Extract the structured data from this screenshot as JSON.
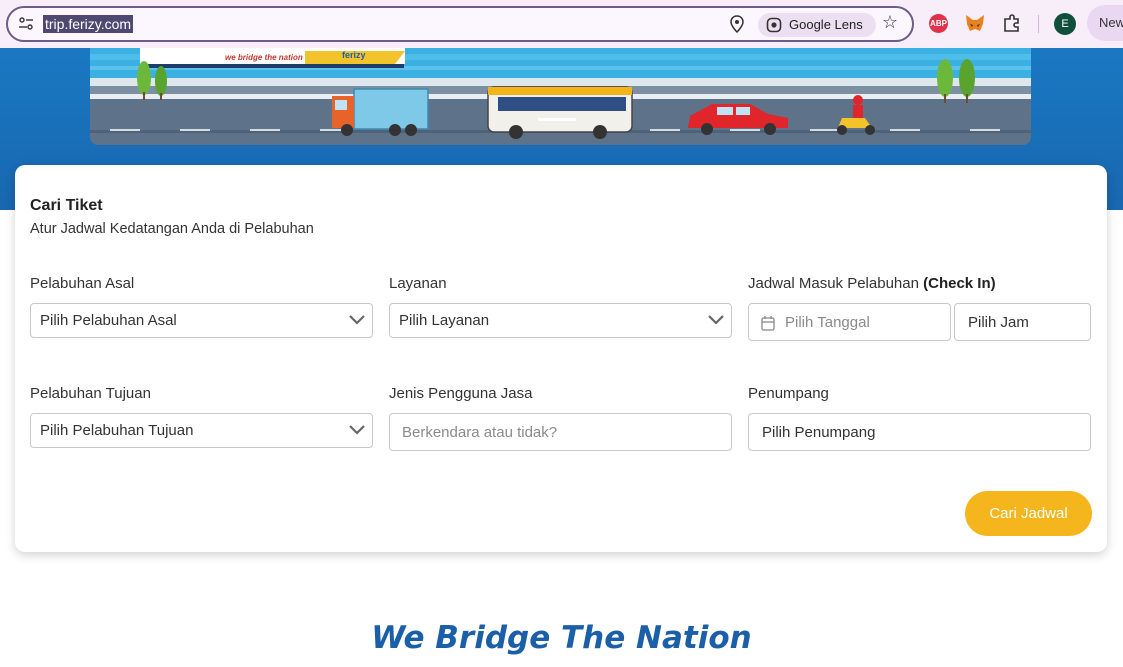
{
  "browser": {
    "url": "trip.ferizy.com",
    "lens_label": "Google Lens",
    "extension_abp": "ABP",
    "profile_initial": "E",
    "new_chip_label": "New"
  },
  "banner": {
    "ship_slogan": "we bridge the nation",
    "ship_brand": "ferizy"
  },
  "search_card": {
    "title": "Cari Tiket",
    "subtitle": "Atur Jadwal Kedatangan Anda di Pelabuhan",
    "origin": {
      "label": "Pelabuhan Asal",
      "value": "Pilih Pelabuhan Asal"
    },
    "service": {
      "label": "Layanan",
      "value": "Pilih Layanan"
    },
    "checkin": {
      "label": "Jadwal Masuk Pelabuhan",
      "label_bold": "(Check In)",
      "date_placeholder": "Pilih Tanggal",
      "time_value": "Pilih Jam"
    },
    "destination": {
      "label": "Pelabuhan Tujuan",
      "value": "Pilih Pelabuhan Tujuan"
    },
    "user_type": {
      "label": "Jenis Pengguna Jasa",
      "placeholder": "Berkendara atau tidak?"
    },
    "passenger": {
      "label": "Penumpang",
      "value": "Pilih Penumpang"
    },
    "submit_label": "Cari Jadwal"
  },
  "tagline": "We Bridge The Nation",
  "colors": {
    "hero_blue": "#1a78c2",
    "button_yellow": "#f5b51c",
    "tagline_blue": "#1b5fa8"
  }
}
